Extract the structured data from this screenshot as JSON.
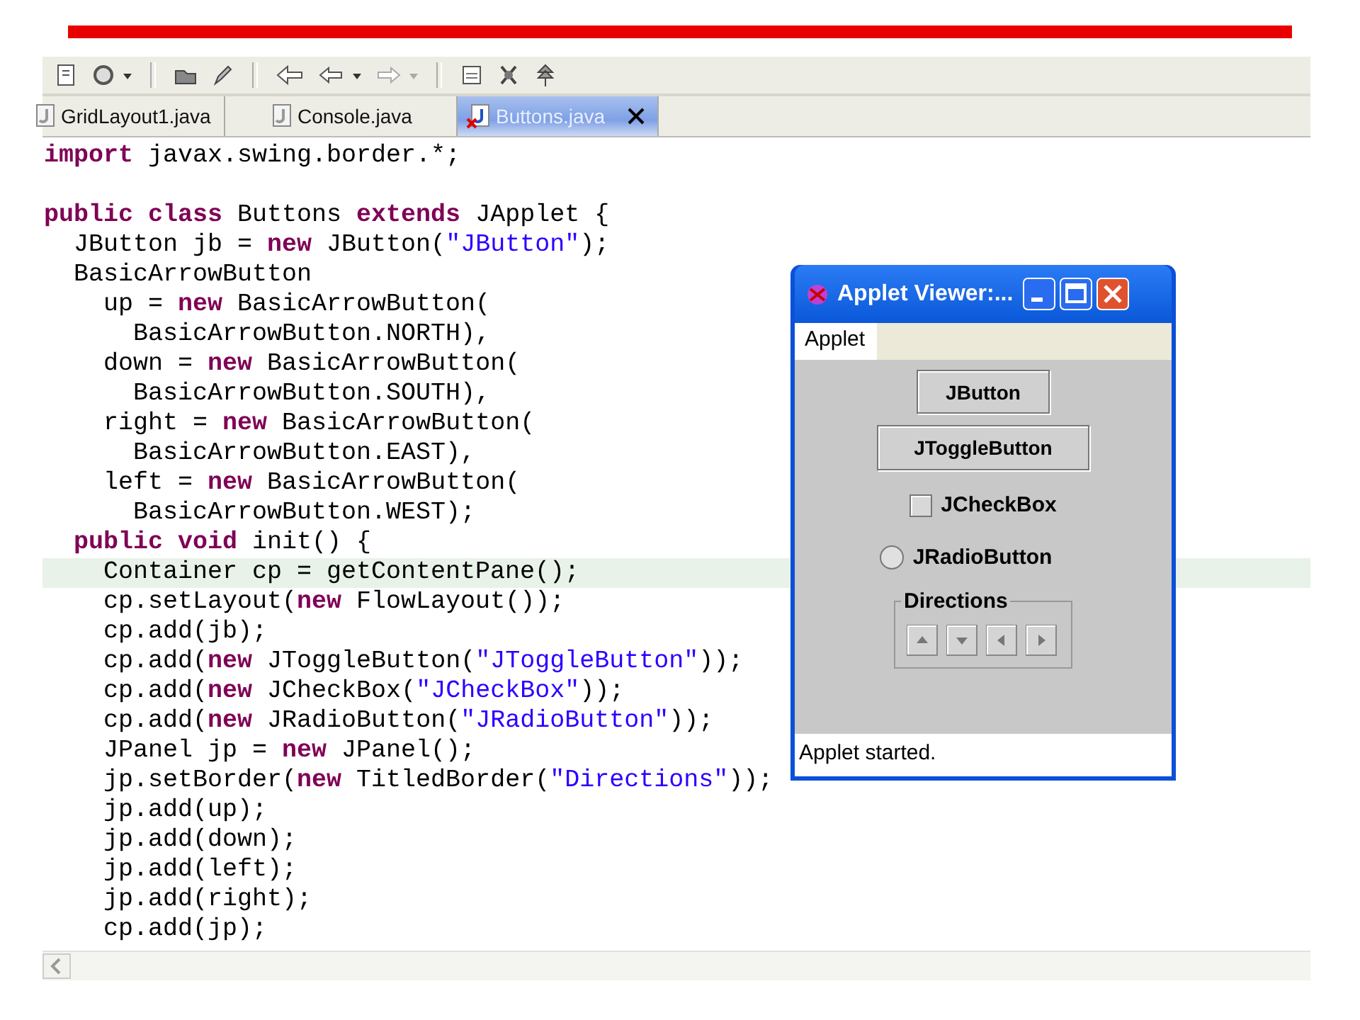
{
  "tabs": [
    {
      "label": "GridLayout1.java",
      "selected": false,
      "error": false,
      "closable": false
    },
    {
      "label": "Console.java",
      "selected": false,
      "error": false,
      "closable": false
    },
    {
      "label": "Buttons.java",
      "selected": true,
      "error": true,
      "closable": true
    }
  ],
  "code": [
    {
      "current": false,
      "tokens": [
        {
          "text": "import",
          "kind": "keyword"
        },
        {
          "text": " javax.swing.border.*;",
          "kind": "plain"
        }
      ]
    },
    {
      "current": false
    },
    {
      "current": false,
      "tokens": [
        {
          "text": "public class",
          "kind": "keyword"
        },
        {
          "text": " Buttons ",
          "kind": "plain"
        },
        {
          "text": "extends",
          "kind": "keyword"
        },
        {
          "text": " JApplet {",
          "kind": "plain"
        }
      ]
    },
    {
      "current": false,
      "tokens": [
        {
          "text": "  JButton jb = ",
          "kind": "plain"
        },
        {
          "text": "new",
          "kind": "keyword"
        },
        {
          "text": " JButton(",
          "kind": "plain"
        },
        {
          "text": "\"JButton\"",
          "kind": "string"
        },
        {
          "text": ");",
          "kind": "plain"
        }
      ]
    },
    {
      "current": false,
      "tokens": [
        {
          "text": "  BasicArrowButton",
          "kind": "plain"
        }
      ]
    },
    {
      "current": false,
      "tokens": [
        {
          "text": "    up = ",
          "kind": "plain"
        },
        {
          "text": "new",
          "kind": "keyword"
        },
        {
          "text": " BasicArrowButton(",
          "kind": "plain"
        }
      ]
    },
    {
      "current": false,
      "tokens": [
        {
          "text": "      BasicArrowButton.NORTH),",
          "kind": "plain"
        }
      ]
    },
    {
      "current": false,
      "tokens": [
        {
          "text": "    down = ",
          "kind": "plain"
        },
        {
          "text": "new",
          "kind": "keyword"
        },
        {
          "text": " BasicArrowButton(",
          "kind": "plain"
        }
      ]
    },
    {
      "current": false,
      "tokens": [
        {
          "text": "      BasicArrowButton.SOUTH),",
          "kind": "plain"
        }
      ]
    },
    {
      "current": false,
      "tokens": [
        {
          "text": "    right = ",
          "kind": "plain"
        },
        {
          "text": "new",
          "kind": "keyword"
        },
        {
          "text": " BasicArrowButton(",
          "kind": "plain"
        }
      ]
    },
    {
      "current": false,
      "tokens": [
        {
          "text": "      BasicArrowButton.EAST),",
          "kind": "plain"
        }
      ]
    },
    {
      "current": false,
      "tokens": [
        {
          "text": "    left = ",
          "kind": "plain"
        },
        {
          "text": "new",
          "kind": "keyword"
        },
        {
          "text": " BasicArrowButton(",
          "kind": "plain"
        }
      ]
    },
    {
      "current": false,
      "tokens": [
        {
          "text": "      BasicArrowButton.WEST);",
          "kind": "plain"
        }
      ]
    },
    {
      "current": false,
      "tokens": [
        {
          "text": "  public void",
          "kind": "keyword"
        },
        {
          "text": " init() {",
          "kind": "plain"
        }
      ]
    },
    {
      "current": true,
      "tokens": [
        {
          "text": "    Container cp = getContentPane();",
          "kind": "plain"
        }
      ]
    },
    {
      "current": false,
      "tokens": [
        {
          "text": "    cp.setLayout(",
          "kind": "plain"
        },
        {
          "text": "new",
          "kind": "keyword"
        },
        {
          "text": " FlowLayout());",
          "kind": "plain"
        }
      ]
    },
    {
      "current": false,
      "tokens": [
        {
          "text": "    cp.add(jb);",
          "kind": "plain"
        }
      ]
    },
    {
      "current": false,
      "tokens": [
        {
          "text": "    cp.add(",
          "kind": "plain"
        },
        {
          "text": "new",
          "kind": "keyword"
        },
        {
          "text": " JToggleButton(",
          "kind": "plain"
        },
        {
          "text": "\"JToggleButton\"",
          "kind": "string"
        },
        {
          "text": "));",
          "kind": "plain"
        }
      ]
    },
    {
      "current": false,
      "tokens": [
        {
          "text": "    cp.add(",
          "kind": "plain"
        },
        {
          "text": "new",
          "kind": "keyword"
        },
        {
          "text": " JCheckBox(",
          "kind": "plain"
        },
        {
          "text": "\"JCheckBox\"",
          "kind": "string"
        },
        {
          "text": "));",
          "kind": "plain"
        }
      ]
    },
    {
      "current": false,
      "tokens": [
        {
          "text": "    cp.add(",
          "kind": "plain"
        },
        {
          "text": "new",
          "kind": "keyword"
        },
        {
          "text": " JRadioButton(",
          "kind": "plain"
        },
        {
          "text": "\"JRadioButton\"",
          "kind": "string"
        },
        {
          "text": "));",
          "kind": "plain"
        }
      ]
    },
    {
      "current": false,
      "tokens": [
        {
          "text": "    JPanel jp = ",
          "kind": "plain"
        },
        {
          "text": "new",
          "kind": "keyword"
        },
        {
          "text": " JPanel();",
          "kind": "plain"
        }
      ]
    },
    {
      "current": false,
      "tokens": [
        {
          "text": "    jp.setBorder(",
          "kind": "plain"
        },
        {
          "text": "new",
          "kind": "keyword"
        },
        {
          "text": " TitledBorder(",
          "kind": "plain"
        },
        {
          "text": "\"Directions\"",
          "kind": "string"
        },
        {
          "text": "));",
          "kind": "plain"
        }
      ]
    },
    {
      "current": false,
      "tokens": [
        {
          "text": "    jp.add(up);",
          "kind": "plain"
        }
      ]
    },
    {
      "current": false,
      "tokens": [
        {
          "text": "    jp.add(down);",
          "kind": "plain"
        }
      ]
    },
    {
      "current": false,
      "tokens": [
        {
          "text": "    jp.add(left);",
          "kind": "plain"
        }
      ]
    },
    {
      "current": false,
      "tokens": [
        {
          "text": "    jp.add(right);",
          "kind": "plain"
        }
      ]
    },
    {
      "current": false,
      "tokens": [
        {
          "text": "    cp.add(jp);",
          "kind": "plain"
        }
      ]
    }
  ],
  "applet": {
    "title": "Applet Viewer:...",
    "menu": [
      "Applet"
    ],
    "components": [
      {
        "kind": "button",
        "label": "JButton"
      },
      {
        "kind": "toggle",
        "label": "JToggleButton",
        "selected": false
      },
      {
        "kind": "checkbox",
        "label": "JCheckBox",
        "checked": false
      },
      {
        "kind": "radio",
        "label": "JRadioButton",
        "selected": false
      },
      {
        "kind": "panel",
        "title": "Directions",
        "arrows": [
          {
            "kind": "up"
          },
          {
            "kind": "down"
          },
          {
            "kind": "left"
          },
          {
            "kind": "right"
          }
        ]
      }
    ],
    "status": "Applet started."
  }
}
